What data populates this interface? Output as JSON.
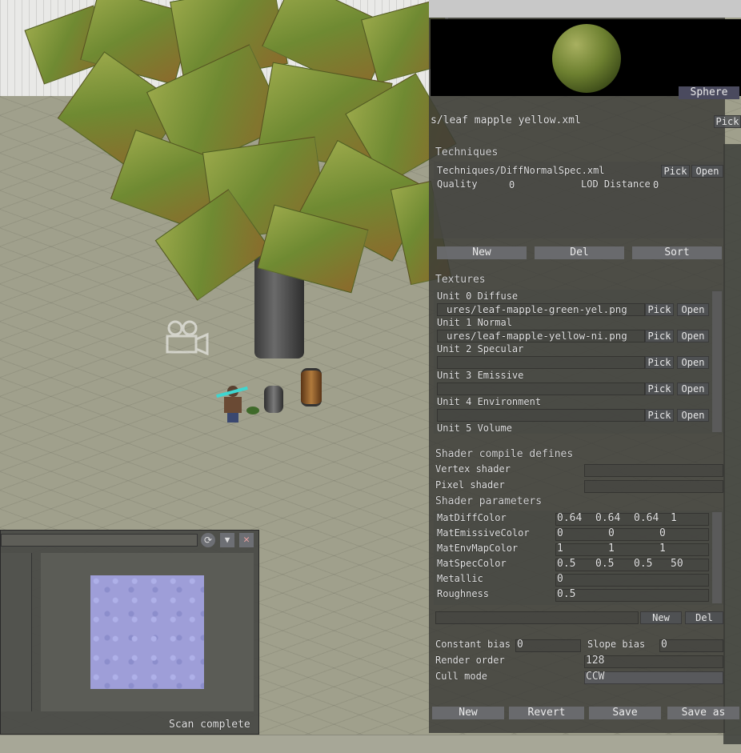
{
  "inspector": {
    "preview_mode_label": "Sphere",
    "material_path": "s/leaf mapple yellow.xml",
    "material_pick_label": "Pick",
    "techniques": {
      "header": "Techniques",
      "path": "Techniques/DiffNormalSpec.xml",
      "pick": "Pick",
      "open": "Open",
      "quality_label": "Quality",
      "quality_value": "0",
      "lod_label": "LOD Distance",
      "lod_value": "0",
      "new": "New",
      "del": "Del",
      "sort": "Sort"
    },
    "textures": {
      "header": "Textures",
      "units": [
        {
          "label": "Unit 0 Diffuse",
          "path": "ures/leaf-mapple-green-yel.png"
        },
        {
          "label": "Unit 1 Normal",
          "path": "ures/leaf-mapple-yellow-ni.png"
        },
        {
          "label": "Unit 2 Specular",
          "path": ""
        },
        {
          "label": "Unit 3 Emissive",
          "path": ""
        },
        {
          "label": "Unit 4 Environment",
          "path": ""
        },
        {
          "label": "Unit 5 Volume",
          "path": ""
        }
      ],
      "pick": "Pick",
      "open": "Open"
    },
    "shader": {
      "defines_header": "Shader compile defines",
      "vertex_label": "Vertex shader",
      "pixel_label": "Pixel shader",
      "params_header": "Shader parameters",
      "params": [
        {
          "name": "MatDiffColor",
          "values": [
            "0.64",
            "0.64",
            "0.64",
            "1"
          ]
        },
        {
          "name": "MatEmissiveColor",
          "values": [
            "0",
            "0",
            "0"
          ]
        },
        {
          "name": "MatEnvMapColor",
          "values": [
            "1",
            "1",
            "1"
          ]
        },
        {
          "name": "MatSpecColor",
          "values": [
            "0.5",
            "0.5",
            "0.5",
            "50"
          ]
        },
        {
          "name": "Metallic",
          "values": [
            "0"
          ]
        },
        {
          "name": "Roughness",
          "values": [
            "0.5"
          ]
        }
      ],
      "new": "New",
      "del": "Del"
    },
    "render": {
      "constant_bias_label": "Constant bias",
      "constant_bias_value": "0",
      "slope_bias_label": "Slope bias",
      "slope_bias_value": "0",
      "render_order_label": "Render order",
      "render_order_value": "128",
      "cull_mode_label": "Cull mode",
      "cull_mode_value": "CCW"
    },
    "footer": {
      "new": "New",
      "revert": "Revert",
      "save": "Save",
      "save_as": "Save as"
    }
  },
  "resource_browser": {
    "status": "Scan complete"
  },
  "icons": {
    "camera": "camera-icon",
    "refresh": "refresh-icon",
    "filter": "filter-icon",
    "close": "close-icon"
  },
  "colors": {
    "floor": "#9a9a86",
    "panel": "#3c3d3a",
    "preview_bg": "#000000",
    "texture_preview": "#9e9ed8"
  }
}
